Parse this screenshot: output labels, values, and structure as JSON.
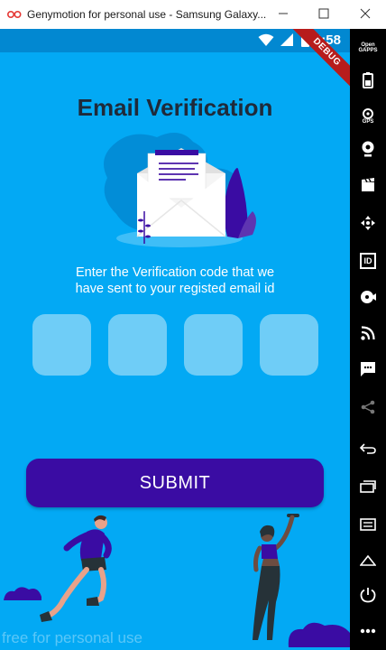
{
  "window": {
    "title": "Genymotion for personal use - Samsung Galaxy...",
    "controls": [
      "minimize-icon",
      "maximize-icon",
      "close-icon"
    ]
  },
  "statusbar": {
    "time": "4:58",
    "icons": [
      "wifi-icon",
      "signal-icon",
      "battery-icon"
    ]
  },
  "debug_banner": "DEBUG",
  "page": {
    "title": "Email Verification",
    "instruction_line1": "Enter the Verification code that we",
    "instruction_line2": "have sent to your registed email id",
    "code_boxes": [
      "",
      "",
      "",
      ""
    ],
    "submit_label": "SUBMIT"
  },
  "watermark": "free for personal use",
  "sidebar": {
    "open_gapps_line1": "Open",
    "open_gapps_line2": "GAPPS",
    "gps_label": "GPS",
    "id_label": "ID",
    "tools": [
      "battery-tool-icon",
      "gps-icon",
      "webcam-icon",
      "media-icon",
      "dpad-icon",
      "id-icon",
      "disk-io-icon",
      "network-icon",
      "sms-icon",
      "share-icon",
      "back-icon",
      "recent-apps-icon",
      "menu-icon",
      "home-icon",
      "power-icon",
      "more-icon"
    ]
  },
  "colors": {
    "screen_bg": "#03a9f4",
    "code_box": "#6fcdf7",
    "submit_bg": "#3a0ca3",
    "heading": "#1f2a3a",
    "sidebar_bg": "#000000"
  }
}
